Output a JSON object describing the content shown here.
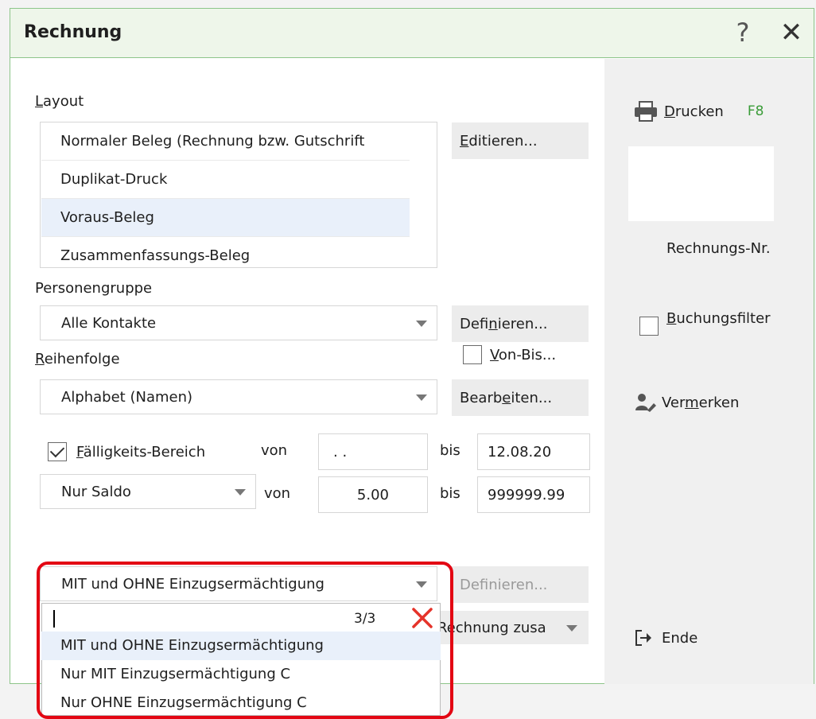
{
  "window": {
    "title": "Rechnung",
    "help": "?",
    "close": "✕"
  },
  "layout": {
    "label_pre": "",
    "label_ul": "L",
    "label_post": "ayout",
    "items": [
      "Normaler Beleg (Rechnung bzw. Gutschrift",
      "Duplikat-Druck",
      "Voraus-Beleg",
      "Zusammenfassungs-Beleg"
    ],
    "selected_index": 2,
    "edit_button_pre": "",
    "edit_button_ul": "E",
    "edit_button_post": "ditieren..."
  },
  "person_group": {
    "label": "Personengruppe",
    "value": "Alle Kontakte",
    "define_pre": "Defi",
    "define_ul": "n",
    "define_post": "ieren...",
    "vonbis_pre": "",
    "vonbis_ul": "V",
    "vonbis_post": "on-Bis..."
  },
  "order": {
    "label_pre": "",
    "label_ul": "R",
    "label_post": "eihenfolge",
    "value": "Alphabet (Namen)",
    "edit_pre": "Bearb",
    "edit_ul": "e",
    "edit_post": "iten..."
  },
  "due_range": {
    "checked": true,
    "label_pre": "",
    "label_ul": "F",
    "label_post": "älligkeits-Bereich",
    "from_label": "von",
    "from_value": ". .",
    "to_label": "bis",
    "to_value": "12.08.20"
  },
  "balance": {
    "value": "Nur Saldo",
    "from_label": "von",
    "from_value": "5.00",
    "to_label": "bis",
    "to_value": "999999.99"
  },
  "direct_debit": {
    "value": "MIT und OHNE Einzugsermächtigung",
    "define": "Definieren...",
    "summary_value": "Rechnung zusa",
    "dropdown": {
      "count": "3/3",
      "options": [
        "MIT und OHNE Einzugsermächtigung",
        "Nur MIT Einzugsermächtigung C",
        "Nur OHNE Einzugsermächtigung C"
      ]
    }
  },
  "sidebar": {
    "print_pre": "",
    "print_ul": "D",
    "print_post": "rucken",
    "print_shortcut": "F8",
    "invoice_no_label": "Rechnungs-Nr.",
    "booking_filter_pre": "",
    "booking_filter_ul": "B",
    "booking_filter_post": "uchungsfilter",
    "note_pre": "Ver",
    "note_ul": "m",
    "note_post": "erken",
    "end": "Ende"
  },
  "colors": {
    "accent_green": "#8dc58a",
    "shortcut_green": "#3a9c38",
    "highlight_red": "#e30613"
  }
}
